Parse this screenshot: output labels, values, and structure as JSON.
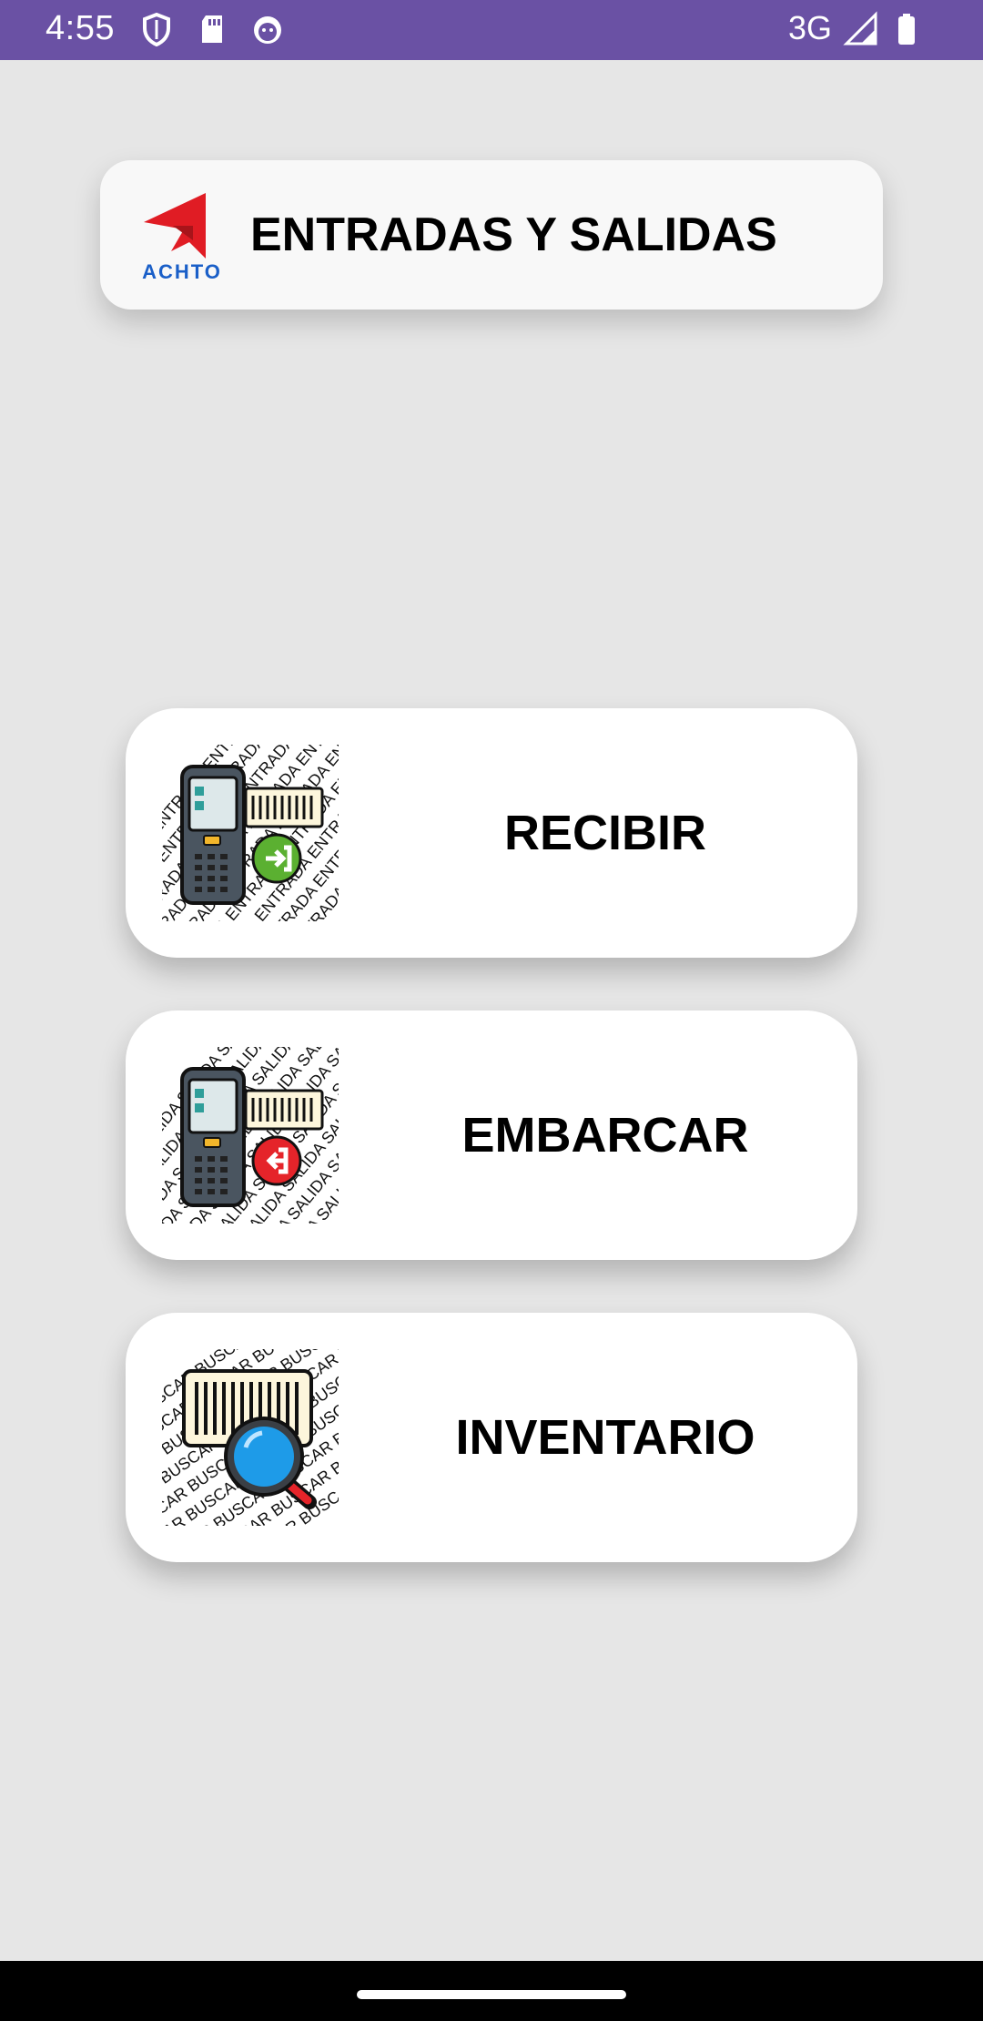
{
  "status_bar": {
    "time": "4:55",
    "network": "3G",
    "icons": [
      "shield-icon",
      "sd-card-icon",
      "cat-icon",
      "signal-icon",
      "battery-icon"
    ],
    "background_color": "#6a51a4"
  },
  "header": {
    "logo_text": "ACHTO",
    "title": "ENTRADAS Y SALIDAS",
    "logo_color": "#e01c24"
  },
  "menu": {
    "items": [
      {
        "label": "RECIBIR",
        "pattern_text": "ENTRADA",
        "badge_color": "#5bb031",
        "icon": "scanner-entry-icon"
      },
      {
        "label": "EMBARCAR",
        "pattern_text": "SALIDA",
        "badge_color": "#e5242a",
        "icon": "scanner-exit-icon"
      },
      {
        "label": "INVENTARIO",
        "pattern_text": "BUSCAR",
        "badge_color": "#1e9be8",
        "icon": "barcode-search-icon"
      }
    ]
  }
}
